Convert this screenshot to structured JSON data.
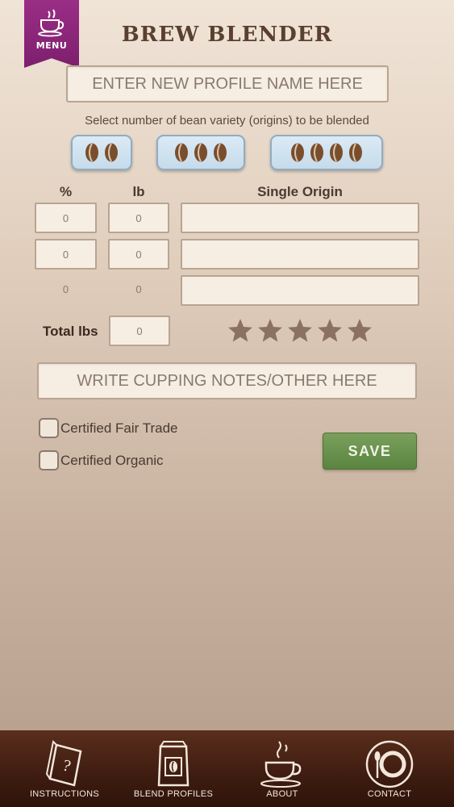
{
  "menu": {
    "label": "MENU",
    "icon": "coffee-cup-icon"
  },
  "app_title": "BREW BLENDER",
  "profile_name": {
    "placeholder": "ENTER NEW PROFILE NAME HERE"
  },
  "bean_selector": {
    "hint": "Select number of bean variety (origins) to be blended",
    "options": [
      {
        "count": 2,
        "icon": "coffee-bean-icon"
      },
      {
        "count": 3,
        "icon": "coffee-bean-icon"
      },
      {
        "count": 4,
        "icon": "coffee-bean-icon"
      }
    ]
  },
  "blend_table": {
    "headers": {
      "percent": "%",
      "lb": "lb",
      "origin": "Single Origin"
    },
    "rows": [
      {
        "percent": "0",
        "lb": "0",
        "origin": ""
      },
      {
        "percent": "0",
        "lb": "0",
        "origin": ""
      },
      {
        "percent": "0",
        "lb": "0",
        "origin": ""
      }
    ]
  },
  "totals": {
    "label": "Total lbs",
    "value": "0"
  },
  "rating": {
    "stars": 0,
    "max": 5,
    "color": "#8a7160"
  },
  "cupping_notes": {
    "placeholder": "WRITE CUPPING NOTES/OTHER HERE"
  },
  "certifications": [
    {
      "label": "Certified Fair Trade",
      "checked": false
    },
    {
      "label": "Certified Organic",
      "checked": false
    }
  ],
  "save_label": "SAVE",
  "colors": {
    "menu": "#8b2679",
    "save": "#6a9150",
    "bean_button": "#cfe1ee",
    "nav_bar": "#3e1c10"
  },
  "bottom_nav": [
    {
      "label": "INSTRUCTIONS",
      "icon": "instructions-book-icon"
    },
    {
      "label": "BLEND PROFILES",
      "icon": "coffee-bag-icon"
    },
    {
      "label": "ABOUT",
      "icon": "coffee-cup-icon"
    },
    {
      "label": "CONTACT",
      "icon": "plate-spoon-icon"
    }
  ]
}
